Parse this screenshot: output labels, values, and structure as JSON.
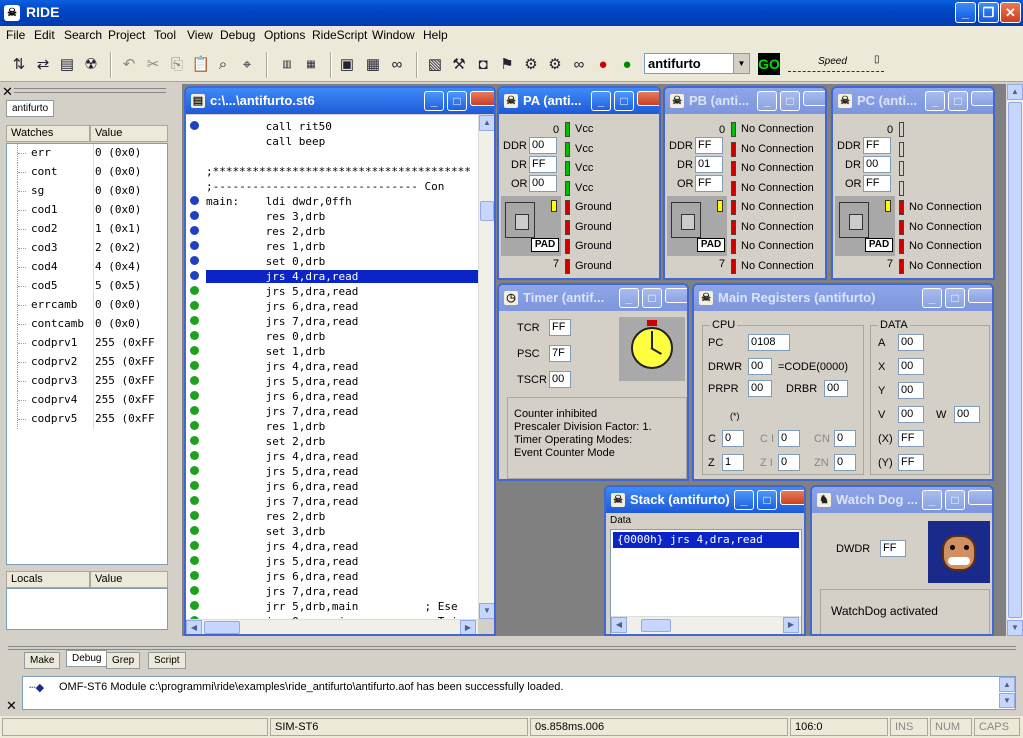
{
  "app": {
    "title": "RIDE"
  },
  "menu": [
    "File",
    "Edit",
    "Search",
    "Project",
    "Tool",
    "View",
    "Debug",
    "Options",
    "RideScript",
    "Window",
    "Help"
  ],
  "toolbar": {
    "target_combo": "antifurto",
    "go_label": "GO",
    "speed_label": "Speed"
  },
  "left": {
    "tab": "antifurto",
    "watches_header": "Watches",
    "value_header": "Value",
    "watches": [
      {
        "name": "err",
        "value": "0  (0x0)"
      },
      {
        "name": "cont",
        "value": "0  (0x0)"
      },
      {
        "name": "sg",
        "value": "0  (0x0)"
      },
      {
        "name": "cod1",
        "value": "0  (0x0)"
      },
      {
        "name": "cod2",
        "value": "1  (0x1)"
      },
      {
        "name": "cod3",
        "value": "2  (0x2)"
      },
      {
        "name": "cod4",
        "value": "4  (0x4)"
      },
      {
        "name": "cod5",
        "value": "5  (0x5)"
      },
      {
        "name": "errcamb",
        "value": "0  (0x0)"
      },
      {
        "name": "contcamb",
        "value": "0  (0x0)"
      },
      {
        "name": "codprv1",
        "value": "255  (0xFF"
      },
      {
        "name": "codprv2",
        "value": "255  (0xFF"
      },
      {
        "name": "codprv3",
        "value": "255  (0xFF"
      },
      {
        "name": "codprv4",
        "value": "255  (0xFF"
      },
      {
        "name": "codprv5",
        "value": "255  (0xFF"
      }
    ],
    "locals_header": "Locals",
    "locals_value_header": "Value"
  },
  "editor": {
    "title": "c:\\...\\antifurto.st6",
    "lines": [
      {
        "bp": "blue",
        "text": "         call rit50"
      },
      {
        "bp": "",
        "text": "         call beep"
      },
      {
        "bp": "",
        "text": ""
      },
      {
        "bp": "",
        "text": ";***************************************"
      },
      {
        "bp": "",
        "text": ";------------------------------- Con"
      },
      {
        "bp": "blue",
        "text": "main:    ldi dwdr,0ffh"
      },
      {
        "bp": "blue",
        "text": "         res 3,drb"
      },
      {
        "bp": "blue",
        "text": "         res 2,drb"
      },
      {
        "bp": "blue",
        "text": "         res 1,drb"
      },
      {
        "bp": "blue",
        "text": "         set 0,drb"
      },
      {
        "bp": "blue",
        "text": "         jrs 4,dra,read",
        "selected": true
      },
      {
        "bp": "green",
        "text": "         jrs 5,dra,read"
      },
      {
        "bp": "green",
        "text": "         jrs 6,dra,read"
      },
      {
        "bp": "green",
        "text": "         jrs 7,dra,read"
      },
      {
        "bp": "green",
        "text": "         res 0,drb"
      },
      {
        "bp": "green",
        "text": "         set 1,drb"
      },
      {
        "bp": "green",
        "text": "         jrs 4,dra,read"
      },
      {
        "bp": "green",
        "text": "         jrs 5,dra,read"
      },
      {
        "bp": "green",
        "text": "         jrs 6,dra,read"
      },
      {
        "bp": "green",
        "text": "         jrs 7,dra,read"
      },
      {
        "bp": "green",
        "text": "         res 1,drb"
      },
      {
        "bp": "green",
        "text": "         set 2,drb"
      },
      {
        "bp": "green",
        "text": "         jrs 4,dra,read"
      },
      {
        "bp": "green",
        "text": "         jrs 5,dra,read"
      },
      {
        "bp": "green",
        "text": "         jrs 6,dra,read"
      },
      {
        "bp": "green",
        "text": "         jrs 7,dra,read"
      },
      {
        "bp": "green",
        "text": "         res 2,drb"
      },
      {
        "bp": "green",
        "text": "         set 3,drb"
      },
      {
        "bp": "green",
        "text": "         jrs 4,dra,read"
      },
      {
        "bp": "green",
        "text": "         jrs 5,dra,read"
      },
      {
        "bp": "green",
        "text": "         jrs 6,dra,read"
      },
      {
        "bp": "green",
        "text": "         jrs 7,dra,read"
      },
      {
        "bp": "green",
        "text": "         jrr 5,drb,main          ; Ese"
      },
      {
        "bp": "green",
        "text": "         jrs 0,sg,main           ; Tri"
      }
    ]
  },
  "ports": [
    {
      "title": "PA (anti...",
      "zero": "0",
      "seven": "7",
      "ddr": "00",
      "dr": "FF",
      "or": "00",
      "pins": [
        "Vcc",
        "Vcc",
        "Vcc",
        "Vcc",
        "Ground",
        "Ground",
        "Ground",
        "Ground"
      ],
      "leds": [
        "green",
        "green",
        "green",
        "green",
        "red",
        "red",
        "red",
        "red"
      ]
    },
    {
      "title": "PB (anti...",
      "zero": "0",
      "seven": "7",
      "ddr": "FF",
      "dr": "01",
      "or": "FF",
      "pins": [
        "No Connection",
        "No Connection",
        "No Connection",
        "No Connection",
        "No Connection",
        "No Connection",
        "No Connection",
        "No Connection"
      ],
      "leds": [
        "green",
        "red",
        "red",
        "red",
        "red",
        "red",
        "red",
        "red"
      ]
    },
    {
      "title": "PC (anti...",
      "zero": "0",
      "seven": "7",
      "ddr": "FF",
      "dr": "00",
      "or": "FF",
      "pins": [
        "",
        "",
        "",
        "",
        "No Connection",
        "No Connection",
        "No Connection",
        "No Connection"
      ],
      "leds": [
        "off",
        "off",
        "off",
        "off",
        "red",
        "red",
        "red",
        "red"
      ]
    }
  ],
  "port_labels": {
    "ddr": "DDR",
    "dr": "DR",
    "or": "OR",
    "pad": "PAD"
  },
  "timer": {
    "title": "Timer (antif...",
    "tcr_label": "TCR",
    "tcr": "FF",
    "psc_label": "PSC",
    "psc": "7F",
    "tscr_label": "TSCR",
    "tscr": "00",
    "info": [
      "Counter inhibited",
      "Prescaler Division Factor:  1.",
      "Timer Operating Modes:",
      "Event Counter Mode"
    ]
  },
  "registers": {
    "title": "Main Registers (antifurto)",
    "cpu_label": "CPU",
    "data_label": "DATA",
    "pc_label": "PC",
    "pc": "0108",
    "drwr_label": "DRWR",
    "drwr": "00",
    "drwr_eq": "=CODE(0000)",
    "prpr_label": "PRPR",
    "prpr": "00",
    "drbr_label": "DRBR",
    "drbr": "00",
    "star": "(*)",
    "c_label": "C",
    "c": "0",
    "ci_label": "C I",
    "ci": "0",
    "cn_label": "CN",
    "cn": "0",
    "z_label": "Z",
    "z": "1",
    "zi_label": "Z I",
    "zi": "0",
    "zn_label": "ZN",
    "zn": "0",
    "a_label": "A",
    "a": "00",
    "x_label": "X",
    "x": "00",
    "y_label": "Y",
    "y": "00",
    "v_label": "V",
    "v": "00",
    "w_label": "W",
    "w": "00",
    "xi_label": "(X)",
    "xi": "FF",
    "yi_label": "(Y)",
    "yi": "FF"
  },
  "stack": {
    "title": "Stack (antifurto)",
    "data_header": "Data",
    "entry": "{0000h} jrs 4,dra,read"
  },
  "watchdog": {
    "title": "Watch Dog ...",
    "dwdr_label": "DWDR",
    "dwdr": "FF",
    "status": "WatchDog activated"
  },
  "bottom": {
    "tabs": [
      "Make",
      "Debug",
      "Grep",
      "Script"
    ],
    "active_tab": "Debug",
    "message": "OMF-ST6 Module c:\\programmi\\ride\\examples\\ride_antifurto\\antifurto.aof has been successfully loaded."
  },
  "status": {
    "sim": "SIM-ST6",
    "time": "0s.858ms.006",
    "pos": "106:0",
    "ins": "INS",
    "num": "NUM",
    "caps": "CAPS"
  }
}
